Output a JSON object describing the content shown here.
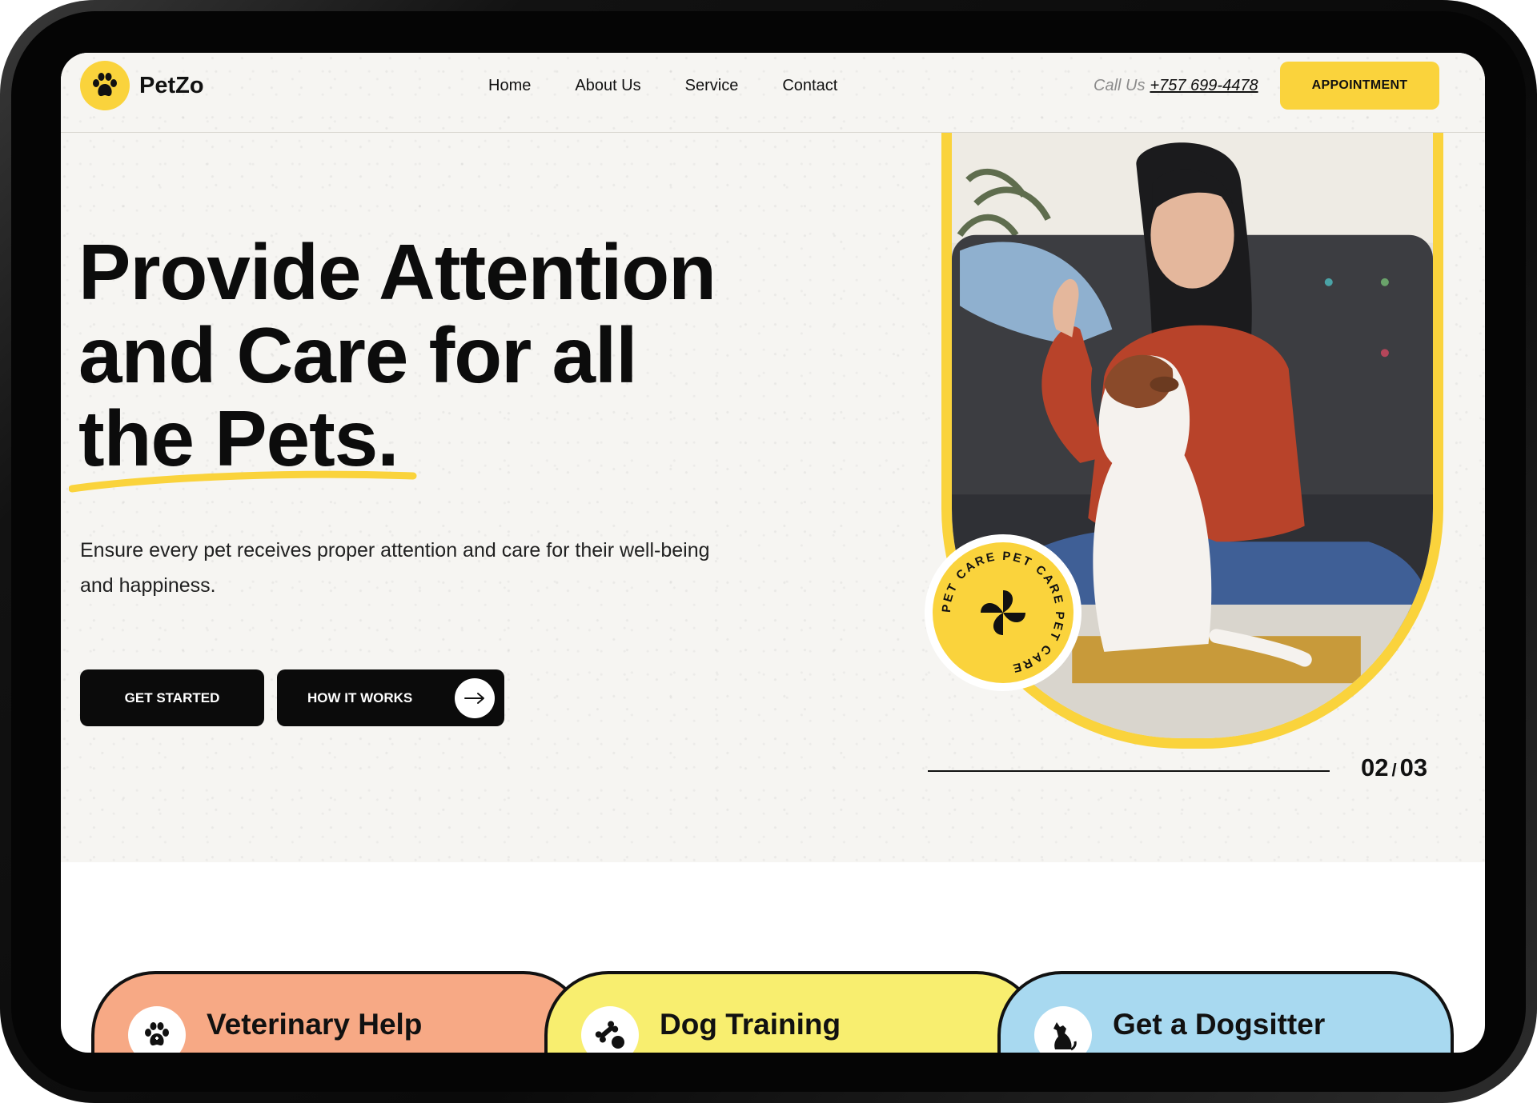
{
  "brand": {
    "name": "PetZo",
    "accent": "#fad33c"
  },
  "nav": {
    "links": [
      "Home",
      "About Us",
      "Service",
      "Contact"
    ],
    "call_label": "Call Us",
    "phone": "+757 699-4478",
    "appointment_label": "APPOINTMENT"
  },
  "hero": {
    "title_line1": "Provide Attention",
    "title_line2": "and Care for all",
    "title_line3": "the Pets.",
    "subtitle": "Ensure every pet receives proper attention and care for their well-being and happiness.",
    "get_started": "GET STARTED",
    "how_it_works": "HOW IT WORKS",
    "badge_text": "PET CARE PET CARE PET CARE",
    "slide_current": "02",
    "slide_sep": "/",
    "slide_total": "03"
  },
  "services": [
    {
      "title": "Veterinary Help",
      "icon": "paw-icon",
      "color": "#f7a985"
    },
    {
      "title": "Dog Training",
      "icon": "bone-ball-icon",
      "color": "#f8ee6f"
    },
    {
      "title": "Get a Dogsitter",
      "icon": "dog-icon",
      "color": "#a8d9f0"
    }
  ]
}
